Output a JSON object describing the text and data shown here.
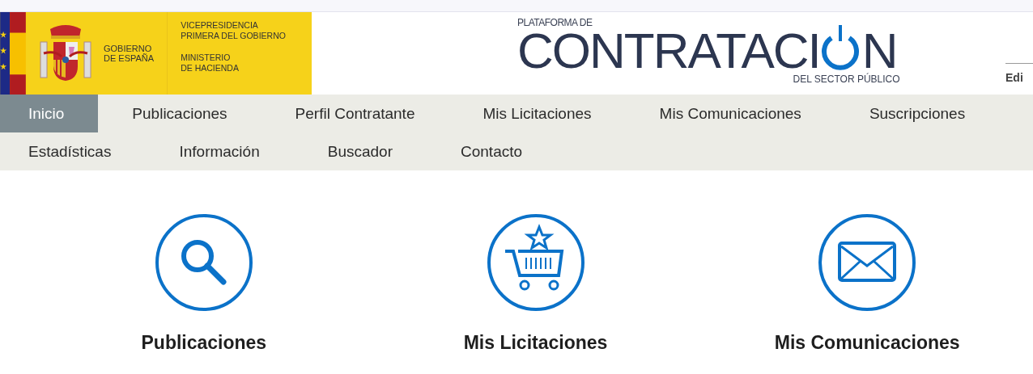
{
  "header": {
    "government": {
      "name_lines": [
        "GOBIERNO",
        "DE ESPAÑA"
      ],
      "department": [
        "VICEPRESIDENCIA",
        "PRIMERA DEL GOBIERNO"
      ],
      "ministry": [
        "MINISTERIO",
        "DE HACIENDA"
      ]
    },
    "platform": {
      "prefix": "PLATAFORMA DE",
      "name_before": "CONTRATACI",
      "name_after": "N",
      "suffix": "DEL SECTOR PÚBLICO"
    },
    "right_text": "Edi"
  },
  "nav": {
    "rows": [
      [
        {
          "label": "Inicio",
          "selected": true
        },
        {
          "label": "Publicaciones",
          "selected": false
        },
        {
          "label": "Perfil Contratante",
          "selected": false
        },
        {
          "label": "Mis Licitaciones",
          "selected": false
        },
        {
          "label": "Mis Comunicaciones",
          "selected": false
        },
        {
          "label": "Suscripciones",
          "selected": false
        }
      ],
      [
        {
          "label": "Estadísticas",
          "selected": false
        },
        {
          "label": "Información",
          "selected": false
        },
        {
          "label": "Buscador",
          "selected": false
        },
        {
          "label": "Contacto",
          "selected": false
        }
      ]
    ]
  },
  "shortcuts": [
    {
      "kind": "search",
      "title": "Publicaciones"
    },
    {
      "kind": "cart",
      "title": "Mis Licitaciones"
    },
    {
      "kind": "mail",
      "title": "Mis Comunicaciones"
    }
  ]
}
